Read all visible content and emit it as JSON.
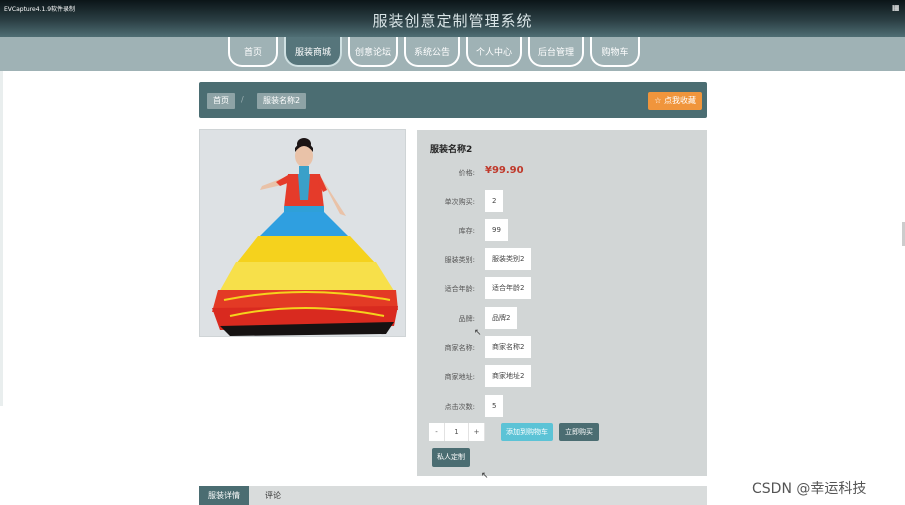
{
  "recorder": {
    "label": "EVCapture4.1.9软件录制"
  },
  "header": {
    "title": "服装创意定制管理系统"
  },
  "nav": {
    "items": [
      {
        "label": "首页"
      },
      {
        "label": "服装商城"
      },
      {
        "label": "创意论坛"
      },
      {
        "label": "系统公告"
      },
      {
        "label": "个人中心"
      },
      {
        "label": "后台管理"
      },
      {
        "label": "购物车"
      }
    ],
    "active_index": 1
  },
  "breadcrumb": {
    "home": "首页",
    "separator": "/",
    "current": "服装名称2",
    "favorite_button": "☆ 点我收藏"
  },
  "product": {
    "name": "服装名称2",
    "price_label": "价格:",
    "price": "¥99.90",
    "fields": [
      {
        "label": "单次购买:",
        "value": "2"
      },
      {
        "label": "库存:",
        "value": "99"
      },
      {
        "label": "服装类别:",
        "value": "服装类别2"
      },
      {
        "label": "适合年龄:",
        "value": "适合年龄2"
      },
      {
        "label": "品牌:",
        "value": "品牌2"
      },
      {
        "label": "商家名称:",
        "value": "商家名称2"
      },
      {
        "label": "商家地址:",
        "value": "商家地址2"
      },
      {
        "label": "点击次数:",
        "value": "5"
      }
    ],
    "quantity": {
      "minus": "-",
      "value": "1",
      "plus": "+"
    },
    "add_to_cart": "添加到购物车",
    "buy_now": "立即购买",
    "custom": "私人定制"
  },
  "tabs": [
    {
      "label": "服装详情"
    },
    {
      "label": "评论"
    }
  ],
  "watermark": "CSDN @幸运科技",
  "colors": {
    "theme": "#4b6d72",
    "nav_bg": "#9fb2b5",
    "favorite": "#f0953c",
    "cart": "#5cc3d6",
    "price": "#c0392b"
  }
}
